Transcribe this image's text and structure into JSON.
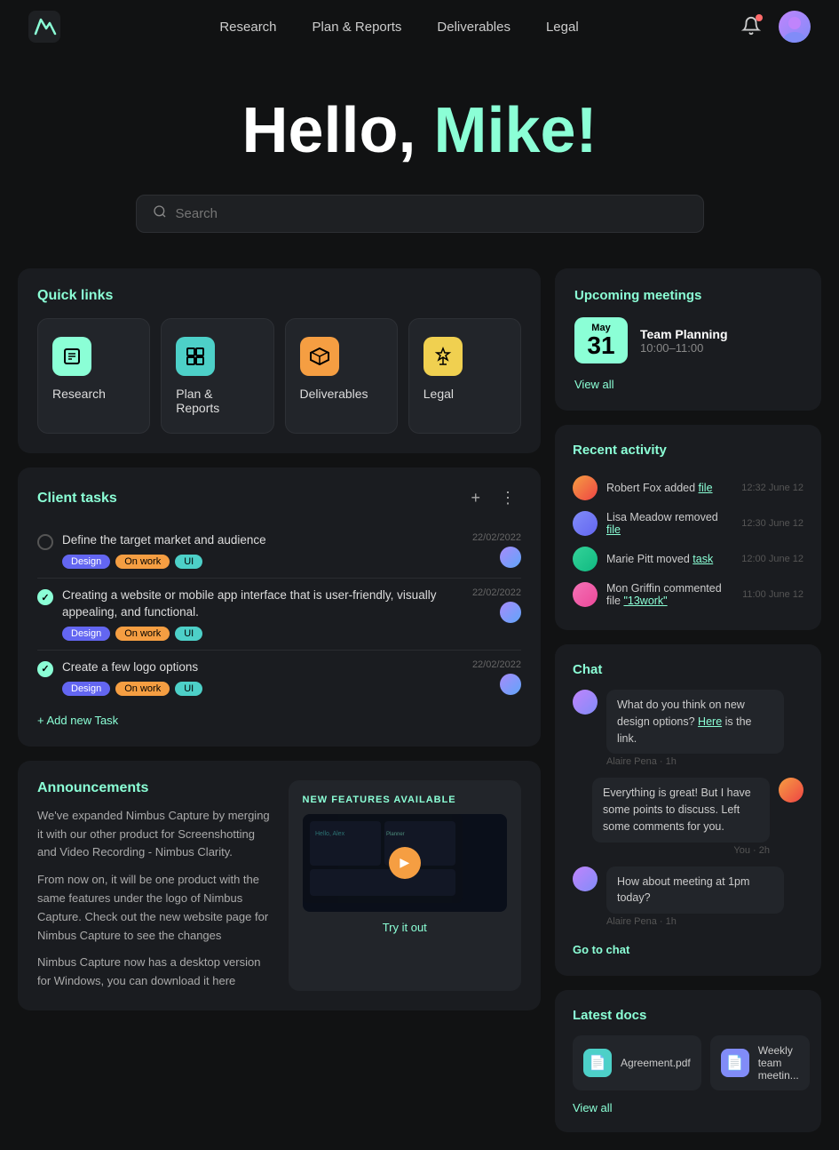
{
  "navbar": {
    "links": [
      {
        "label": "Research",
        "id": "research"
      },
      {
        "label": "Plan & Reports",
        "id": "plan-reports"
      },
      {
        "label": "Deliverables",
        "id": "deliverables"
      },
      {
        "label": "Legal",
        "id": "legal"
      }
    ]
  },
  "hero": {
    "greeting": "Hello, ",
    "name": "Mike!"
  },
  "search": {
    "placeholder": "Search"
  },
  "quicklinks": {
    "title": "Quick links",
    "items": [
      {
        "label": "Research",
        "icon": "📋",
        "icon_class": "icon-green"
      },
      {
        "label": "Plan & Reports",
        "icon": "📊",
        "icon_class": "icon-teal"
      },
      {
        "label": "Deliverables",
        "icon": "📦",
        "icon_class": "icon-orange"
      },
      {
        "label": "Legal",
        "icon": "⚖️",
        "icon_class": "icon-yellow"
      }
    ]
  },
  "client_tasks": {
    "title": "Client tasks",
    "add_label": "+ Add new Task",
    "tasks": [
      {
        "title": "Define the target market and audience",
        "tags": [
          "Design",
          "On work",
          "UI"
        ],
        "date": "22/02/2022",
        "done": false
      },
      {
        "title": "Creating a website or mobile app interface that is user-friendly, visually appealing, and functional.",
        "tags": [
          "Design",
          "On work",
          "UI"
        ],
        "date": "22/02/2022",
        "done": true
      },
      {
        "title": "Create a few logo options",
        "tags": [
          "Design",
          "On work",
          "UI"
        ],
        "date": "22/02/2022",
        "done": true
      }
    ]
  },
  "announcements": {
    "title": "Announcements",
    "body1": "We've expanded Nimbus Capture by merging it with our other product for Screenshotting and Video Recording - Nimbus Clarity.",
    "body2": "From now on, it will be one product with the same features under the logo of Nimbus Capture. Check out the new website page for Nimbus Capture to see the changes",
    "body3": "Nimbus Capture now has a desktop version for Windows, you can download it here",
    "new_features_label": "NEW FEATURES AVAILABLE",
    "try_it_out": "Try it out"
  },
  "upcoming_meetings": {
    "title": "Upcoming meetings",
    "meeting": {
      "month": "May",
      "day": "31",
      "name": "Team Planning",
      "time": "10:00–11:00"
    },
    "view_all": "View all"
  },
  "recent_activity": {
    "title": "Recent activity",
    "items": [
      {
        "user": "Robert Fox",
        "action": "added",
        "target": "file",
        "time": "12:32 June 12"
      },
      {
        "user": "Lisa Meadow",
        "action": "removed",
        "target": "file",
        "time": "12:30 June 12"
      },
      {
        "user": "Marie Pitt",
        "action": "moved",
        "target": "task",
        "time": "12:00 June 12"
      },
      {
        "user": "Mon Griffin",
        "action": "commented file",
        "target": "\"13work\"",
        "time": "11:00 June 12"
      }
    ]
  },
  "chat": {
    "title": "Chat",
    "messages": [
      {
        "sender": "Alaire Pena",
        "text_before": "What do you think on new design options?",
        "link": "Here",
        "text_after": "is the link.",
        "meta": "Alaire Pena · 1h",
        "side": "left"
      },
      {
        "sender": "You",
        "text": "Everything is great! But I have some points to discuss. Left some comments for you.",
        "meta": "You · 2h",
        "side": "right"
      },
      {
        "sender": "Alaire Pena",
        "text": "How about meeting at 1pm today?",
        "meta": "Alaire Pena · 1h",
        "side": "left"
      }
    ],
    "go_to_chat": "Go to chat"
  },
  "latest_docs": {
    "title": "Latest docs",
    "docs": [
      {
        "name": "Agreement.pdf"
      },
      {
        "name": "Weekly team meetin..."
      }
    ],
    "view_all": "View all"
  }
}
